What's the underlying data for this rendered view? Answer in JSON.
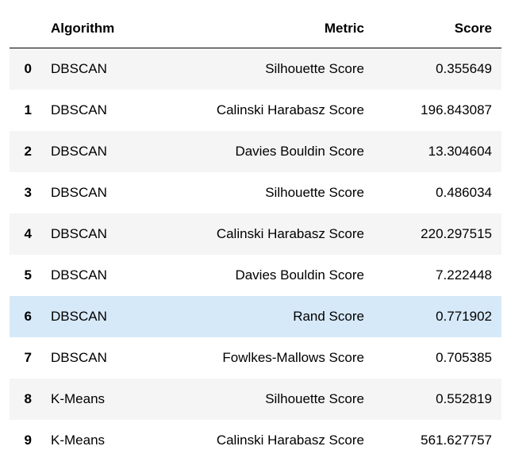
{
  "columns": {
    "index": "",
    "algorithm": "Algorithm",
    "metric": "Metric",
    "score": "Score"
  },
  "rows": [
    {
      "idx": "0",
      "algorithm": "DBSCAN",
      "metric": "Silhouette Score",
      "score": "0.355649"
    },
    {
      "idx": "1",
      "algorithm": "DBSCAN",
      "metric": "Calinski Harabasz Score",
      "score": "196.843087"
    },
    {
      "idx": "2",
      "algorithm": "DBSCAN",
      "metric": "Davies Bouldin Score",
      "score": "13.304604"
    },
    {
      "idx": "3",
      "algorithm": "DBSCAN",
      "metric": "Silhouette Score",
      "score": "0.486034"
    },
    {
      "idx": "4",
      "algorithm": "DBSCAN",
      "metric": "Calinski Harabasz Score",
      "score": "220.297515"
    },
    {
      "idx": "5",
      "algorithm": "DBSCAN",
      "metric": "Davies Bouldin Score",
      "score": "7.222448"
    },
    {
      "idx": "6",
      "algorithm": "DBSCAN",
      "metric": "Rand Score",
      "score": "0.771902"
    },
    {
      "idx": "7",
      "algorithm": "DBSCAN",
      "metric": "Fowlkes-Mallows Score",
      "score": "0.705385"
    },
    {
      "idx": "8",
      "algorithm": "K-Means",
      "metric": "Silhouette Score",
      "score": "0.552819"
    },
    {
      "idx": "9",
      "algorithm": "K-Means",
      "metric": "Calinski Harabasz Score",
      "score": "561.627757"
    }
  ],
  "selected_row_index": 6
}
